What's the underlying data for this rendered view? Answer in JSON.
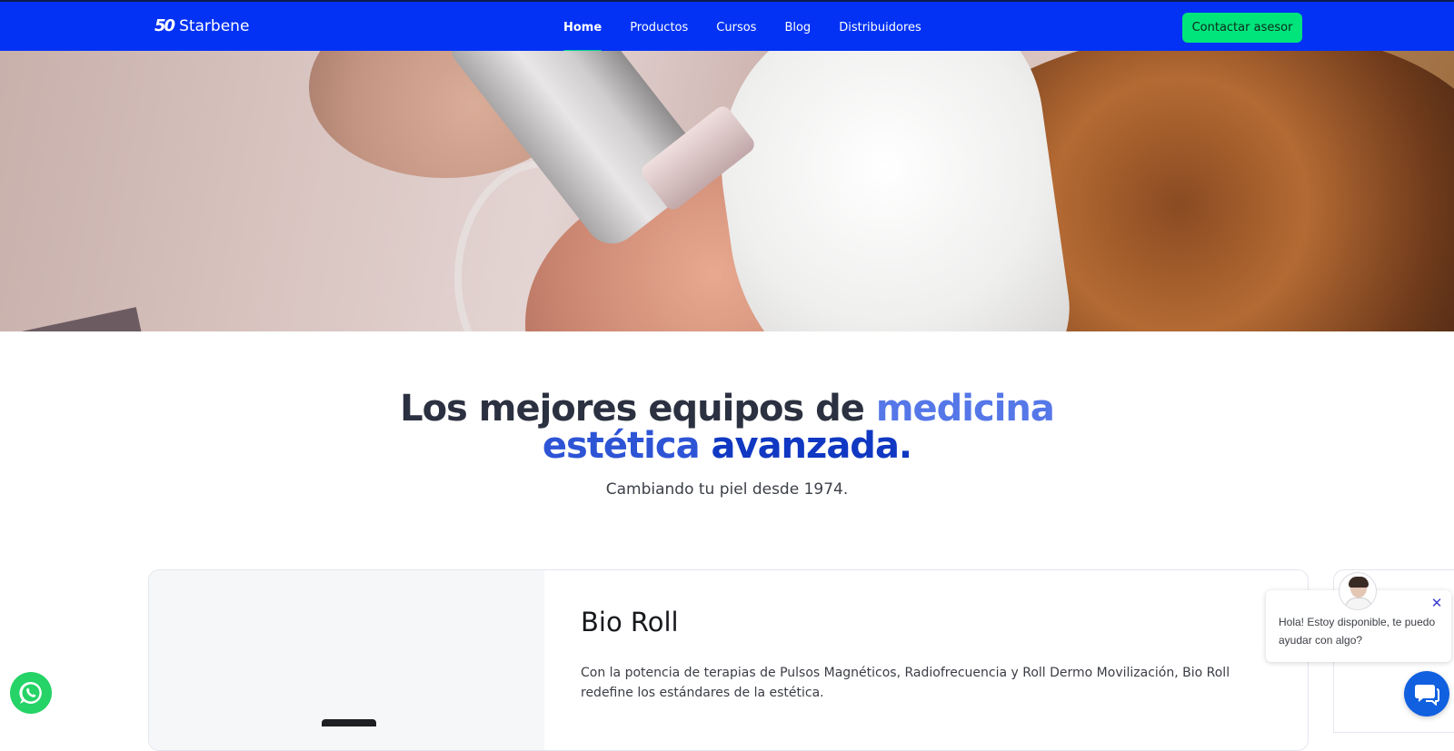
{
  "navbar": {
    "logo_mark": "50",
    "logo_text": "Starbene",
    "links": [
      {
        "label": "Home",
        "active": true
      },
      {
        "label": "Productos",
        "active": false
      },
      {
        "label": "Cursos",
        "active": false
      },
      {
        "label": "Blog",
        "active": false
      },
      {
        "label": "Distribuidores",
        "active": false
      }
    ],
    "cta_label": "Contactar asesor"
  },
  "hero": {
    "headline_part1": "Los mejores equipos de ",
    "headline_part2": "medicina",
    "headline_part3": "estética ",
    "headline_part4": "avanzada.",
    "subheadline": "Cambiando tu piel desde 1974."
  },
  "product": {
    "title": "Bio Roll",
    "description": "Con la potencia de terapias de Pulsos Magnéticos, Radiofrecuencia y Roll Dermo Movilización, Bio Roll redefine los estándares de la estética."
  },
  "chat": {
    "message": "Hola! Estoy disponible, te puedo ayudar con algo?",
    "close_icon": "close-icon",
    "launcher_icon": "chat-icon"
  },
  "floating": {
    "whatsapp_icon": "whatsapp-icon"
  },
  "colors": {
    "nav_bg": "#0332f4",
    "cta_bg": "#00e47c",
    "active_underline": "#00d68f",
    "headline_dark": "#2b3140",
    "headline_accent_light": "#5577e8",
    "headline_accent_dark": "#1038c2",
    "whatsapp": "#25d366",
    "chat_launcher": "#1060e0"
  }
}
